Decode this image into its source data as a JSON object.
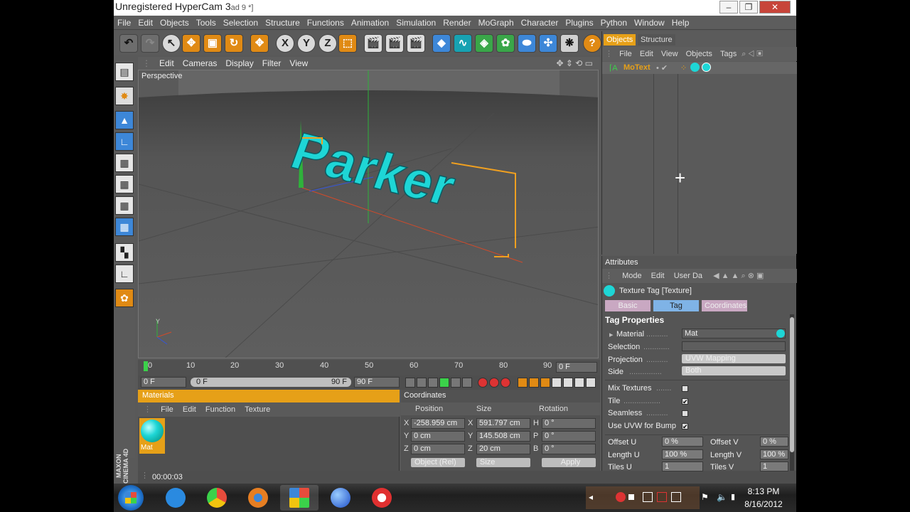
{
  "window": {
    "title": "Unregistered HyperCam 3",
    "title_suffix": "ad 9 *]",
    "minimize": "–",
    "maximize": "❐",
    "close": "✕"
  },
  "menubar": [
    "File",
    "Edit",
    "Objects",
    "Tools",
    "Selection",
    "Structure",
    "Functions",
    "Animation",
    "Simulation",
    "Render",
    "MoGraph",
    "Character",
    "Plugins",
    "Python",
    "Window",
    "Help"
  ],
  "viewport": {
    "menu": [
      "Edit",
      "Cameras",
      "Display",
      "Filter",
      "View"
    ],
    "label": "Perspective",
    "text3d": "Parker",
    "axis_y": "Y"
  },
  "timeline": {
    "ticks": [
      "0",
      "10",
      "20",
      "30",
      "40",
      "50",
      "60",
      "70",
      "80",
      "90"
    ],
    "current_frame": "0 F",
    "start_field": "0 F",
    "slider_left": "0 F",
    "slider_right": "90 F",
    "end_field": "90 F"
  },
  "materials": {
    "title": "Materials",
    "menu": [
      "File",
      "Edit",
      "Function",
      "Texture"
    ],
    "items": [
      {
        "name": "Mat",
        "color": "#1ed6d6"
      }
    ]
  },
  "coordinates": {
    "title": "Coordinates",
    "headers": [
      "Position",
      "Size",
      "Rotation"
    ],
    "rows": [
      {
        "axis": "X",
        "pos": "-258.959 cm",
        "size_axis": "X",
        "size": "591.797 cm",
        "rot_axis": "H",
        "rot": "0 °"
      },
      {
        "axis": "Y",
        "pos": "0 cm",
        "size_axis": "Y",
        "size": "145.508 cm",
        "rot_axis": "P",
        "rot": "0 °"
      },
      {
        "axis": "Z",
        "pos": "0 cm",
        "size_axis": "Z",
        "size": "20 cm",
        "rot_axis": "B",
        "rot": "0 °"
      }
    ],
    "mode": "Object (Rel)",
    "size_mode": "Size",
    "apply": "Apply"
  },
  "status": {
    "time": "00:00:03"
  },
  "object_manager": {
    "tabs": [
      "Objects",
      "Structure"
    ],
    "menu": [
      "File",
      "Edit",
      "View",
      "Objects",
      "Tags"
    ],
    "object": "MoText"
  },
  "attributes": {
    "title": "Attributes",
    "menu": [
      "Mode",
      "Edit",
      "User Da"
    ],
    "header": "Texture Tag [Texture]",
    "tabs": [
      "Basic",
      "Tag",
      "Coordinates"
    ],
    "section": "Tag Properties",
    "material_label": "Material",
    "material_value": "Mat",
    "selection_label": "Selection",
    "projection_label": "Projection",
    "projection_value": "UVW Mapping",
    "side_label": "Side",
    "side_value": "Both",
    "mix_textures": "Mix Textures",
    "tile": "Tile",
    "seamless": "Seamless",
    "use_uvw": "Use UVW for Bump",
    "offset_u": "Offset U",
    "offset_u_val": "0 %",
    "offset_v": "Offset V",
    "offset_v_val": "0 %",
    "length_u": "Length U",
    "length_u_val": "100 %",
    "length_v": "Length V",
    "length_v_val": "100 %",
    "tiles_u": "Tiles U",
    "tiles_u_val": "1",
    "tiles_v": "Tiles V",
    "tiles_v_val": "1"
  },
  "branding": {
    "text": "MAXON CINEMA 4D"
  },
  "taskbar": {
    "time": "8:13 PM",
    "date": "8/16/2012"
  }
}
